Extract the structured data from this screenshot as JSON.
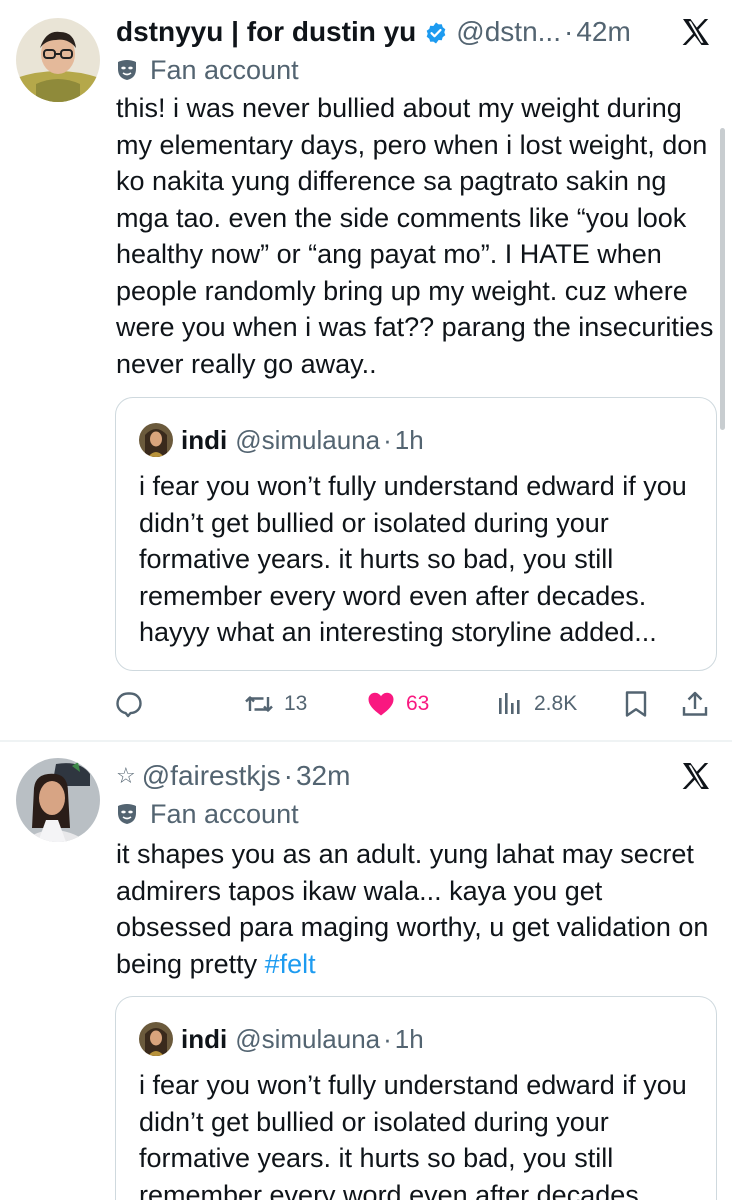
{
  "tweets": [
    {
      "display_name": "dstnyyu | for dustin yu",
      "handle": "@dstn...",
      "dot": "·",
      "time": "42m",
      "label": "Fan account",
      "text": "this! i was never bullied about my weight during my elementary days, pero when i lost weight, don ko nakita yung difference sa pagtrato sakin ng mga tao. even the side comments like “you look healthy now” or “ang payat mo”. I HATE when people randomly bring up my weight. cuz where were you when i was fat?? parang the insecurities never really go away..",
      "quote": {
        "name": "indi",
        "handle": "@simulauna",
        "dot": "·",
        "time": "1h",
        "text": "i fear you won’t fully understand edward if you didn’t get bullied or isolated during your formative years. it hurts so bad, you still remember every word even after decades. hayyy what an interesting storyline added..."
      },
      "actions": {
        "retweets": "13",
        "likes": "63",
        "views": "2.8K"
      }
    },
    {
      "prefix": "☆",
      "handle": "@fairestkjs",
      "dot": "·",
      "time": "32m",
      "label": "Fan account",
      "text": "it shapes you as an adult. yung lahat may secret admirers tapos ikaw wala... kaya you get obsessed para maging worthy, u get validation on being pretty ",
      "hashtag": "#felt",
      "quote": {
        "name": "indi",
        "handle": "@simulauna",
        "dot": "·",
        "time": "1h",
        "text": "i fear you won’t fully understand edward if you didn’t get bullied or isolated during your formative years. it hurts so bad, you still remember every word even after decades."
      }
    }
  ],
  "colors": {
    "text": "#0f1419",
    "secondary": "#536471",
    "verified": "#1d9bf0",
    "like": "#f91880",
    "hashtag": "#1d9bf0",
    "border": "#cfd9de"
  },
  "icons": {
    "verified": "verified-badge-icon",
    "x_logo": "x-logo-icon",
    "fan_label": "mask-icon",
    "reply": "reply-icon",
    "retweet": "retweet-icon",
    "like": "heart-icon",
    "views": "views-icon",
    "bookmark": "bookmark-icon",
    "share": "share-icon"
  }
}
